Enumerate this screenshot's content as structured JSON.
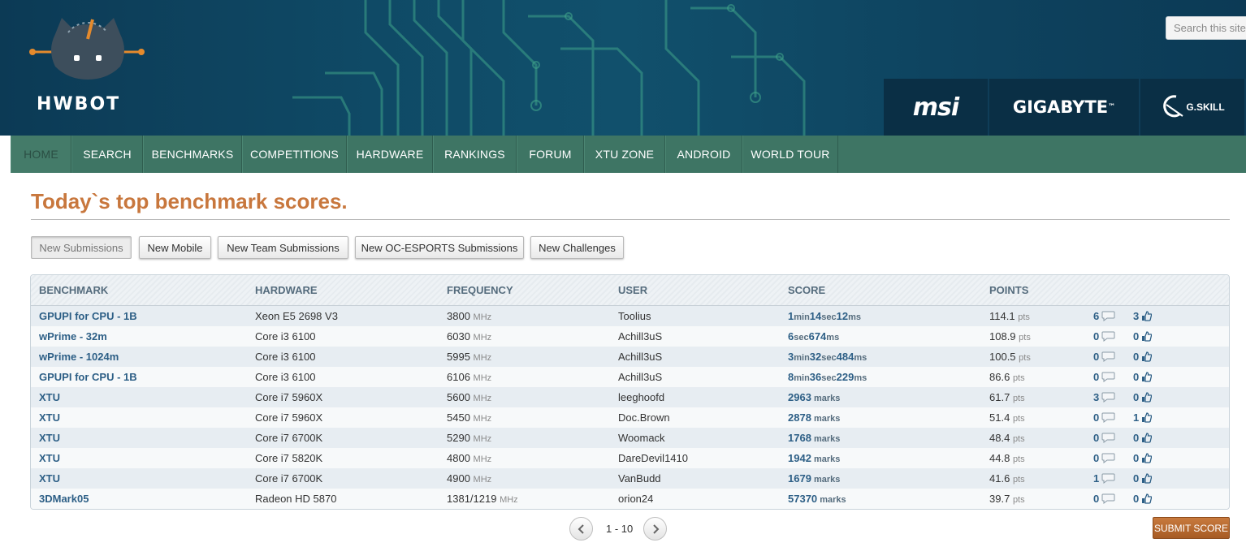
{
  "header": {
    "logo_text": "HWBOT",
    "search_placeholder": "Search this site",
    "sponsors": [
      "msi",
      "GIGABYTE",
      "G.SKILL"
    ],
    "sponsor_mark": "™"
  },
  "nav": {
    "items": [
      "HOME",
      "SEARCH",
      "BENCHMARKS",
      "COMPETITIONS",
      "HARDWARE",
      "RANKINGS",
      "FORUM",
      "XTU ZONE",
      "ANDROID",
      "WORLD TOUR"
    ],
    "active": "HOME"
  },
  "page_title": "Today`s top benchmark scores.",
  "filters": [
    "New Submissions",
    "New Mobile",
    "New Team Submissions",
    "New OC-ESPORTS Submissions",
    "New Challenges"
  ],
  "table": {
    "headers": [
      "BENCHMARK",
      "HARDWARE",
      "FREQUENCY",
      "USER",
      "SCORE",
      "POINTS"
    ],
    "freq_unit": "MHz",
    "pts_unit": "pts",
    "rows": [
      {
        "benchmark": "GPUPI for CPU - 1B",
        "hardware": "Xeon E5 2698 V3",
        "freq": "3800",
        "user": "Toolius",
        "score": [
          [
            "1",
            "min"
          ],
          [
            "14",
            "sec"
          ],
          [
            "12",
            "ms"
          ]
        ],
        "points": "114.1",
        "comments": "6",
        "likes": "3"
      },
      {
        "benchmark": "wPrime - 32m",
        "hardware": "Core i3 6100",
        "freq": "6030",
        "user": "Achill3uS",
        "score": [
          [
            "6",
            "sec"
          ],
          [
            "674",
            "ms"
          ]
        ],
        "points": "108.9",
        "comments": "0",
        "likes": "0"
      },
      {
        "benchmark": "wPrime - 1024m",
        "hardware": "Core i3 6100",
        "freq": "5995",
        "user": "Achill3uS",
        "score": [
          [
            "3",
            "min"
          ],
          [
            "32",
            "sec"
          ],
          [
            "484",
            "ms"
          ]
        ],
        "points": "100.5",
        "comments": "0",
        "likes": "0"
      },
      {
        "benchmark": "GPUPI for CPU - 1B",
        "hardware": "Core i3 6100",
        "freq": "6106",
        "user": "Achill3uS",
        "score": [
          [
            "8",
            "min"
          ],
          [
            "36",
            "sec"
          ],
          [
            "229",
            "ms"
          ]
        ],
        "points": "86.6",
        "comments": "0",
        "likes": "0"
      },
      {
        "benchmark": "XTU",
        "hardware": "Core i7 5960X",
        "freq": "5600",
        "user": "leeghoofd",
        "score": [
          [
            "2963",
            " marks"
          ]
        ],
        "points": "61.7",
        "comments": "3",
        "likes": "0"
      },
      {
        "benchmark": "XTU",
        "hardware": "Core i7 5960X",
        "freq": "5450",
        "user": "Doc.Brown",
        "score": [
          [
            "2878",
            " marks"
          ]
        ],
        "points": "51.4",
        "comments": "0",
        "likes": "1"
      },
      {
        "benchmark": "XTU",
        "hardware": "Core i7 6700K",
        "freq": "5290",
        "user": "Woomack",
        "score": [
          [
            "1768",
            " marks"
          ]
        ],
        "points": "48.4",
        "comments": "0",
        "likes": "0"
      },
      {
        "benchmark": "XTU",
        "hardware": "Core i7 5820K",
        "freq": "4800",
        "user": "DareDevil1410",
        "score": [
          [
            "1942",
            " marks"
          ]
        ],
        "points": "44.8",
        "comments": "0",
        "likes": "0"
      },
      {
        "benchmark": "XTU",
        "hardware": "Core i7 6700K",
        "freq": "4900",
        "user": "VanBudd",
        "score": [
          [
            "1679",
            " marks"
          ]
        ],
        "points": "41.6",
        "comments": "1",
        "likes": "0"
      },
      {
        "benchmark": "3DMark05",
        "hardware": "Radeon HD 5870",
        "freq": "1381/1219",
        "user": "orion24",
        "score": [
          [
            "57370",
            " marks"
          ]
        ],
        "points": "39.7",
        "comments": "0",
        "likes": "0"
      }
    ]
  },
  "pager": {
    "range": "1 - 10"
  },
  "submit_label": "SUBMIT SCORE",
  "colors": {
    "accent": "#c8773d",
    "nav": "#3e7564",
    "header": "#0f4a66",
    "link": "#2d5f86"
  }
}
